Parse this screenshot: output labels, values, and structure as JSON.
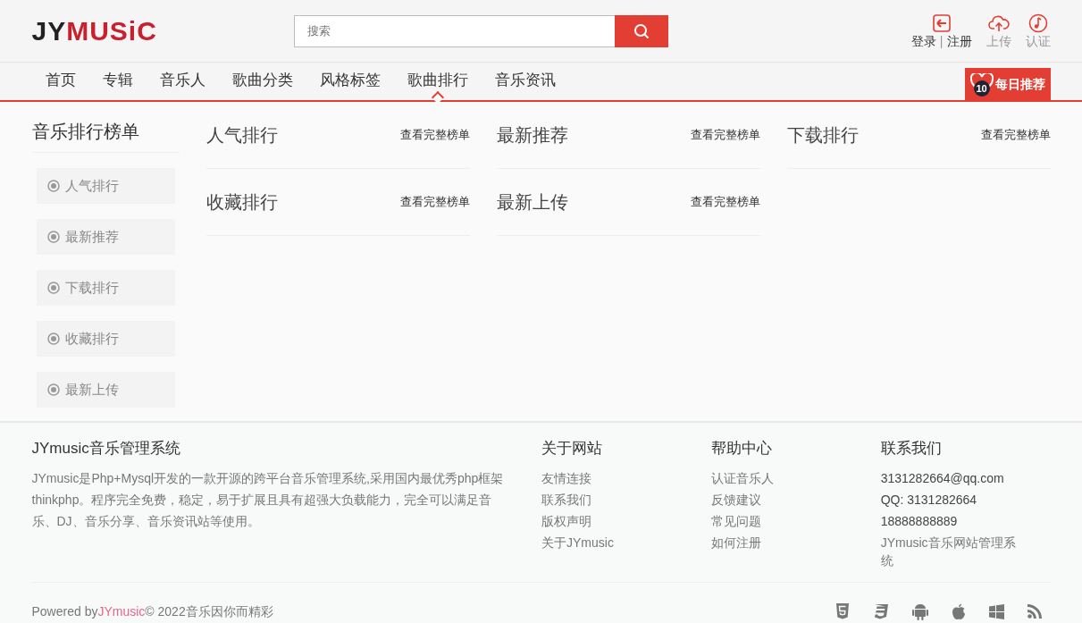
{
  "logo": {
    "dark": "JY",
    "accent": "MUSiC"
  },
  "search": {
    "placeholder": "搜索"
  },
  "user_actions": [
    {
      "kind": "login",
      "parts": [
        "登录",
        "|",
        "注册"
      ]
    },
    {
      "kind": "upload",
      "parts": [
        "上传"
      ]
    },
    {
      "kind": "verify",
      "parts": [
        "认证"
      ]
    }
  ],
  "nav": [
    {
      "label": "首页",
      "selected": false
    },
    {
      "label": "专辑",
      "selected": false
    },
    {
      "label": "音乐人",
      "selected": false
    },
    {
      "label": "歌曲分类",
      "selected": false
    },
    {
      "label": "风格标签",
      "selected": false
    },
    {
      "label": "歌曲排行",
      "selected": true
    },
    {
      "label": "音乐资讯",
      "selected": false
    }
  ],
  "daily": {
    "count": "10",
    "label": "每日推荐"
  },
  "sidebar": {
    "title": "音乐排行榜单",
    "items": [
      "人气排行",
      "最新推荐",
      "下载排行",
      "收藏排行",
      "最新上传"
    ]
  },
  "charts": [
    {
      "title": "人气排行",
      "link": "查看完整榜单"
    },
    {
      "title": "最新推荐",
      "link": "查看完整榜单"
    },
    {
      "title": "下载排行",
      "link": "查看完整榜单"
    },
    {
      "title": "收藏排行",
      "link": "查看完整榜单"
    },
    {
      "title": "最新上传",
      "link": "查看完整榜单"
    }
  ],
  "footer": {
    "about": {
      "title": "JYmusic音乐管理系统",
      "text": "JYmusic是Php+Mysql开发的一款开源的跨平台音乐管理系统,采用国内最优秀php框架thinkphp。程序完全免费，稳定，易于扩展且具有超强大负载能力，完全可以满足音乐、DJ、音乐分享、音乐资讯站等使用。"
    },
    "columns": [
      {
        "title": "关于网站",
        "kind": "links",
        "items": [
          "友情连接",
          "联系我们",
          "版权声明",
          "关于JYmusic"
        ]
      },
      {
        "title": "帮助中心",
        "kind": "links",
        "items": [
          "认证音乐人",
          "反馈建议",
          "常见问题",
          "如何注册"
        ]
      },
      {
        "title": "联系我们",
        "kind": "contact",
        "items": [
          "3131282664@qq.com",
          "QQ: 3131282664",
          "18888888889",
          "JYmusic音乐网站管理系统"
        ]
      }
    ],
    "powered_prefix": "Powered by",
    "powered_link": "JYmusic",
    "powered_suffix": "© 2022音乐因你而精彩",
    "platform_icons": [
      {
        "kind": "html5"
      },
      {
        "kind": "css3"
      },
      {
        "kind": "android"
      },
      {
        "kind": "apple"
      },
      {
        "kind": "windows"
      },
      {
        "kind": "rss"
      }
    ]
  }
}
